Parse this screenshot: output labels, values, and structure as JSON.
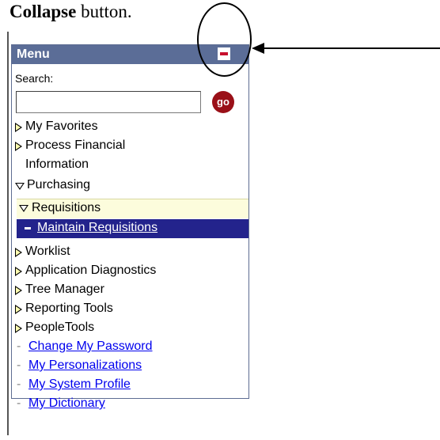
{
  "caption": {
    "bold": "Collapse",
    "rest": " button."
  },
  "menu": {
    "title": "Menu",
    "search_label": "Search:",
    "search_value": "",
    "go_label": "go",
    "items": [
      {
        "label": "My Favorites"
      },
      {
        "label": "Process Financial"
      },
      {
        "label": "Information"
      },
      {
        "label": "Purchasing"
      },
      {
        "label": "Requisitions"
      },
      {
        "label": "Maintain Requisitions"
      },
      {
        "label": "Worklist"
      },
      {
        "label": "Application Diagnostics"
      },
      {
        "label": "Tree Manager"
      },
      {
        "label": "Reporting Tools"
      },
      {
        "label": "PeopleTools"
      },
      {
        "label": "Change My Password"
      },
      {
        "label": "My Personalizations"
      },
      {
        "label": "My System Profile"
      },
      {
        "label": "My Dictionary"
      }
    ],
    "dash_glyph": "-"
  },
  "colors": {
    "header_bg": "#5b6d97",
    "selected_bg": "#23238c",
    "requisitions_bg": "#fcfcdc",
    "link": "#0000ee",
    "collapse_icon": "#c8102e",
    "go_button": "#9a1018"
  },
  "icons": {
    "collapse": "minus-square-icon",
    "folder_collapsed": "triangle-right-icon",
    "folder_expanded": "triangle-down-icon"
  }
}
